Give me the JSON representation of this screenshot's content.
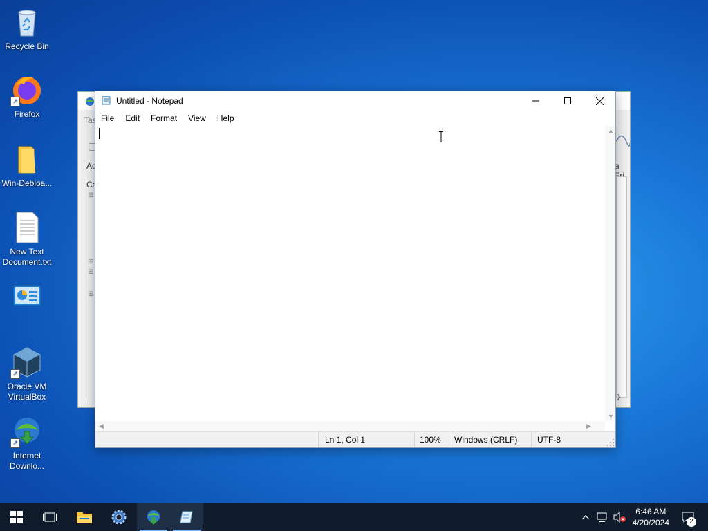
{
  "desktop": {
    "icons": [
      {
        "label": "Recycle Bin",
        "icon": "recycle-bin-icon"
      },
      {
        "label": "Firefox",
        "icon": "firefox-icon"
      },
      {
        "label": "Win-Debloa...",
        "icon": "folder-icon"
      },
      {
        "label": "New Text Document.txt",
        "icon": "text-file-icon"
      },
      {
        "label": "",
        "icon": "control-panel-icon"
      },
      {
        "label": "Oracle VM VirtualBox",
        "icon": "virtualbox-icon"
      },
      {
        "label": "Internet Downlo...",
        "icon": "internet-download-manager-icon"
      }
    ]
  },
  "background_window": {
    "fragments": [
      "Tas",
      "Ad",
      "Ca",
      "a Fri"
    ]
  },
  "notepad": {
    "title": "Untitled - Notepad",
    "menu": [
      "File",
      "Edit",
      "Format",
      "View",
      "Help"
    ],
    "content": "",
    "status": {
      "position": "Ln 1, Col 1",
      "zoom": "100%",
      "line_ending": "Windows (CRLF)",
      "encoding": "UTF-8"
    }
  },
  "taskbar": {
    "clock_time": "6:46 AM",
    "clock_date": "4/20/2024",
    "notification_count": "2"
  }
}
